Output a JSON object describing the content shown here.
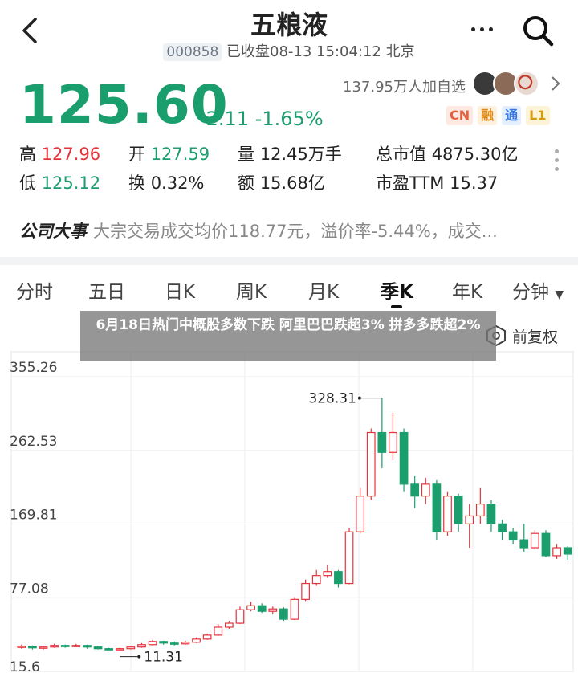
{
  "header": {
    "title": "五粮液",
    "code": "000858",
    "status": "已收盘08-13 15:04:12 北京"
  },
  "quote": {
    "price": "125.60",
    "change": "-2.11 -1.65%",
    "watchlist": "137.95万人加自选",
    "badges": [
      "CN",
      "融",
      "通",
      "L1"
    ]
  },
  "stats": {
    "high_label": "高",
    "high_value": "127.96",
    "open_label": "开",
    "open_value": "127.59",
    "volume_label": "量",
    "volume_value": "12.45万手",
    "mcap_label": "总市值",
    "mcap_value": "4875.30亿",
    "low_label": "低",
    "low_value": "125.12",
    "turnover_label": "换",
    "turnover_value": "0.32%",
    "amount_label": "额",
    "amount_value": "15.68亿",
    "pe_label": "市盈TTM",
    "pe_value": "15.37"
  },
  "event": {
    "title": "公司大事",
    "text": "大宗交易成交均价118.77元，溢价率-5.44%，成交..."
  },
  "tabs": [
    "分时",
    "五日",
    "日K",
    "周K",
    "月K",
    "季K",
    "年K",
    "分钟"
  ],
  "active_tab": "季K",
  "chart": {
    "adjust_label": "前复权",
    "y_ticks": [
      "355.26",
      "262.53",
      "169.81",
      "77.08",
      "15.6"
    ],
    "max_label": "328.31",
    "min_label": "11.31",
    "colors": {
      "up": "#e5333b",
      "down": "#1a9e6d"
    }
  },
  "banner": {
    "text": "6月18日热门中概股多数下跌 阿里巴巴跌超3% 拼多多跌超2%"
  },
  "chart_data": {
    "type": "candlestick",
    "x_label": "",
    "y_label": "",
    "ylim": [
      -15.6,
      355.26
    ],
    "candles": [
      {
        "o": 15,
        "c": 16,
        "h": 18,
        "l": 13
      },
      {
        "o": 16,
        "c": 14,
        "h": 17,
        "l": 12
      },
      {
        "o": 14,
        "c": 15,
        "h": 16,
        "l": 12
      },
      {
        "o": 15,
        "c": 17,
        "h": 19,
        "l": 14
      },
      {
        "o": 17,
        "c": 16,
        "h": 18,
        "l": 14
      },
      {
        "o": 16,
        "c": 17,
        "h": 19,
        "l": 15
      },
      {
        "o": 17,
        "c": 15,
        "h": 18,
        "l": 13
      },
      {
        "o": 15,
        "c": 13,
        "h": 16,
        "l": 12
      },
      {
        "o": 13,
        "c": 12,
        "h": 14,
        "l": 11.31
      },
      {
        "o": 12,
        "c": 13,
        "h": 14,
        "l": 11
      },
      {
        "o": 13,
        "c": 15,
        "h": 16,
        "l": 12
      },
      {
        "o": 15,
        "c": 18,
        "h": 20,
        "l": 14
      },
      {
        "o": 18,
        "c": 22,
        "h": 24,
        "l": 17
      },
      {
        "o": 22,
        "c": 20,
        "h": 23,
        "l": 18
      },
      {
        "o": 20,
        "c": 19,
        "h": 22,
        "l": 17
      },
      {
        "o": 19,
        "c": 21,
        "h": 23,
        "l": 18
      },
      {
        "o": 21,
        "c": 25,
        "h": 27,
        "l": 20
      },
      {
        "o": 25,
        "c": 30,
        "h": 32,
        "l": 24
      },
      {
        "o": 30,
        "c": 40,
        "h": 44,
        "l": 29
      },
      {
        "o": 40,
        "c": 45,
        "h": 48,
        "l": 38
      },
      {
        "o": 45,
        "c": 62,
        "h": 66,
        "l": 44
      },
      {
        "o": 62,
        "c": 67,
        "h": 72,
        "l": 60
      },
      {
        "o": 67,
        "c": 60,
        "h": 70,
        "l": 58
      },
      {
        "o": 60,
        "c": 63,
        "h": 66,
        "l": 56
      },
      {
        "o": 63,
        "c": 50,
        "h": 65,
        "l": 48
      },
      {
        "o": 50,
        "c": 75,
        "h": 78,
        "l": 49
      },
      {
        "o": 75,
        "c": 95,
        "h": 100,
        "l": 73
      },
      {
        "o": 95,
        "c": 105,
        "h": 112,
        "l": 92
      },
      {
        "o": 105,
        "c": 110,
        "h": 118,
        "l": 102
      },
      {
        "o": 110,
        "c": 95,
        "h": 112,
        "l": 90
      },
      {
        "o": 95,
        "c": 160,
        "h": 165,
        "l": 94
      },
      {
        "o": 160,
        "c": 205,
        "h": 215,
        "l": 158
      },
      {
        "o": 205,
        "c": 285,
        "h": 290,
        "l": 200
      },
      {
        "o": 285,
        "c": 260,
        "h": 328.31,
        "l": 240
      },
      {
        "o": 260,
        "c": 285,
        "h": 310,
        "l": 250
      },
      {
        "o": 285,
        "c": 220,
        "h": 290,
        "l": 210
      },
      {
        "o": 220,
        "c": 205,
        "h": 230,
        "l": 190
      },
      {
        "o": 205,
        "c": 220,
        "h": 228,
        "l": 195
      },
      {
        "o": 220,
        "c": 160,
        "h": 225,
        "l": 150
      },
      {
        "o": 160,
        "c": 205,
        "h": 210,
        "l": 155
      },
      {
        "o": 205,
        "c": 170,
        "h": 208,
        "l": 160
      },
      {
        "o": 170,
        "c": 180,
        "h": 195,
        "l": 140
      },
      {
        "o": 180,
        "c": 195,
        "h": 215,
        "l": 170
      },
      {
        "o": 195,
        "c": 170,
        "h": 200,
        "l": 160
      },
      {
        "o": 170,
        "c": 160,
        "h": 175,
        "l": 150
      },
      {
        "o": 160,
        "c": 150,
        "h": 165,
        "l": 145
      },
      {
        "o": 150,
        "c": 140,
        "h": 170,
        "l": 135
      },
      {
        "o": 140,
        "c": 158,
        "h": 162,
        "l": 138
      },
      {
        "o": 158,
        "c": 130,
        "h": 162,
        "l": 128
      },
      {
        "o": 130,
        "c": 140,
        "h": 145,
        "l": 126
      },
      {
        "o": 140,
        "c": 132,
        "h": 142,
        "l": 125
      }
    ]
  }
}
